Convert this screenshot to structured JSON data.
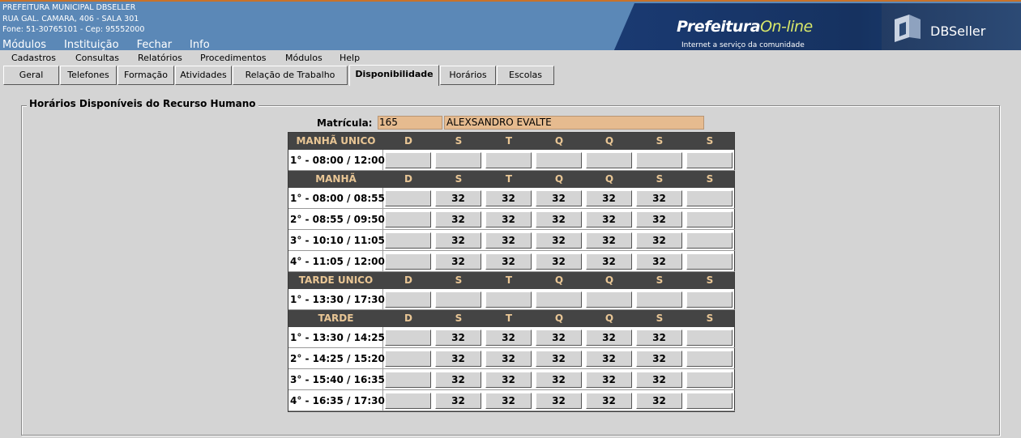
{
  "header": {
    "org_name": "PREFEITURA MUNICIPAL DBSELLER",
    "address": "RUA GAL. CAMARA, 406 - SALA 301",
    "phone": "Fone: 51-30765101  -  Cep: 95552000",
    "top_menu": [
      "Módulos",
      "Instituição",
      "Fechar",
      "Info"
    ],
    "brand_name_a": "Prefeitura",
    "brand_name_b": "On-line",
    "brand_tagline": "Internet a serviço da comunidade",
    "vendor_logo": "DBSeller"
  },
  "menubar": [
    "Cadastros",
    "Consultas",
    "Relatórios",
    "Procedimentos",
    "Módulos",
    "Help"
  ],
  "tabs": [
    "Geral",
    "Telefones",
    "Formação",
    "Atividades",
    "Relação de Trabalho",
    "Disponibilidade",
    "Horários",
    "Escolas"
  ],
  "active_tab": "Disponibilidade",
  "section_title": "Horários Disponíveis do Recurso Humano",
  "matricula": {
    "label": "Matrícula:",
    "code": "165",
    "name": "ALEXSANDRO EVALTE"
  },
  "day_headers": [
    "D",
    "S",
    "T",
    "Q",
    "Q",
    "S",
    "S"
  ],
  "blocks": [
    {
      "title": "MANHÃ UNICO",
      "periods": [
        {
          "label": "1° - 08:00 / 12:00",
          "values": [
            "",
            "",
            "",
            "",
            "",
            "",
            ""
          ]
        }
      ]
    },
    {
      "title": "MANHÃ",
      "periods": [
        {
          "label": "1° - 08:00 / 08:55",
          "values": [
            "",
            "32",
            "32",
            "32",
            "32",
            "32",
            ""
          ]
        },
        {
          "label": "2° - 08:55 / 09:50",
          "values": [
            "",
            "32",
            "32",
            "32",
            "32",
            "32",
            ""
          ]
        },
        {
          "label": "3° - 10:10 / 11:05",
          "values": [
            "",
            "32",
            "32",
            "32",
            "32",
            "32",
            ""
          ]
        },
        {
          "label": "4° - 11:05 / 12:00",
          "values": [
            "",
            "32",
            "32",
            "32",
            "32",
            "32",
            ""
          ]
        }
      ]
    },
    {
      "title": "TARDE UNICO",
      "periods": [
        {
          "label": "1° - 13:30 / 17:30",
          "values": [
            "",
            "",
            "",
            "",
            "",
            "",
            ""
          ]
        }
      ]
    },
    {
      "title": "TARDE",
      "periods": [
        {
          "label": "1° - 13:30 / 14:25",
          "values": [
            "",
            "32",
            "32",
            "32",
            "32",
            "32",
            ""
          ]
        },
        {
          "label": "2° - 14:25 / 15:20",
          "values": [
            "",
            "32",
            "32",
            "32",
            "32",
            "32",
            ""
          ]
        },
        {
          "label": "3° - 15:40 / 16:35",
          "values": [
            "",
            "32",
            "32",
            "32",
            "32",
            "32",
            ""
          ]
        },
        {
          "label": "4° - 16:35 / 17:30",
          "values": [
            "",
            "32",
            "32",
            "32",
            "32",
            "32",
            ""
          ]
        }
      ]
    }
  ]
}
